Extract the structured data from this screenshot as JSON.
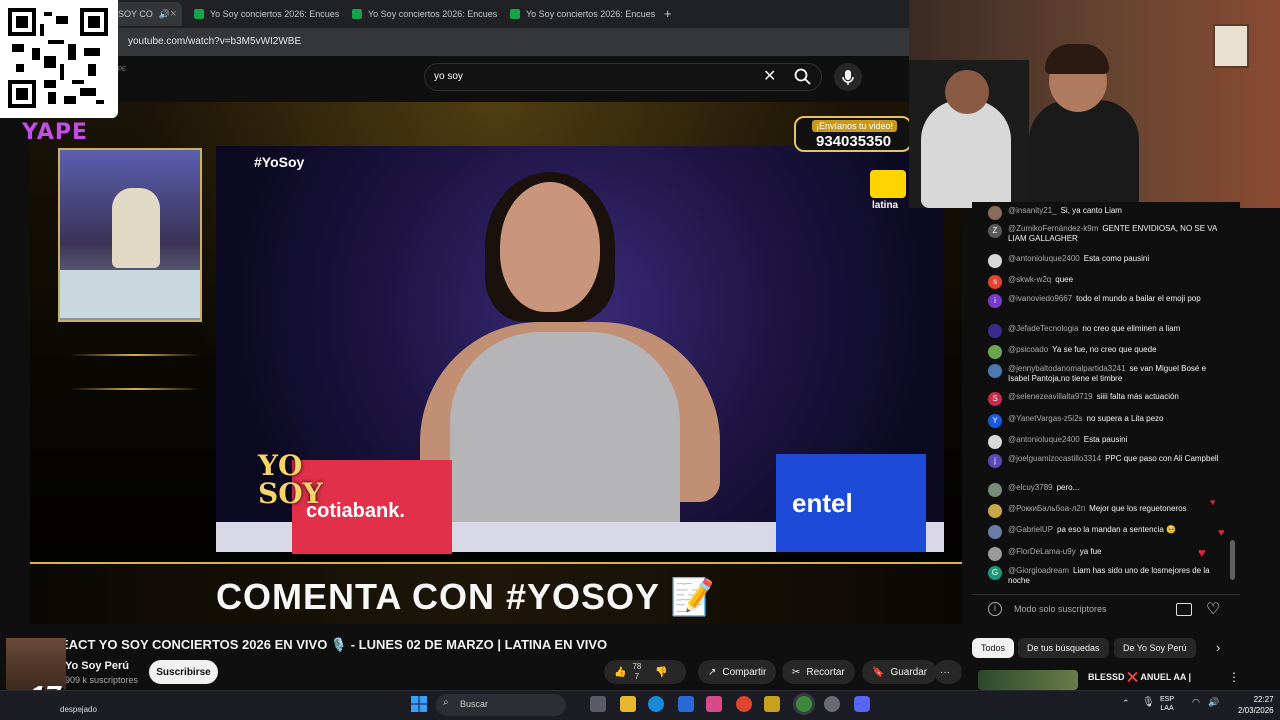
{
  "browser": {
    "tabs": [
      {
        "label": "SOY CO"
      },
      {
        "label": "Yo Soy conciertos 2026: Encues"
      },
      {
        "label": "Yo Soy conciertos 2026: Encues"
      },
      {
        "label": "Yo Soy conciertos 2026: Encues"
      }
    ],
    "url": "youtube.com/watch?v=b3M5vWI2WBE"
  },
  "overlay": {
    "yape_label": "YAPE",
    "logo_small": "PE"
  },
  "youtube": {
    "search_value": "yo soy"
  },
  "video": {
    "hashtag": "#YoSoy",
    "channel_logo": "latina",
    "phone_title": "¡Envíanos tu video!",
    "phone_number": "934035350",
    "sponsor_left": "cotiabank.",
    "sponsor_right": "entel",
    "yosoy_logo_line1": "YO",
    "yosoy_logo_line2": "SOY",
    "banner": "COMENTA CON #YOSOY 📝"
  },
  "video_info": {
    "title": "EACT YO SOY CONCIERTOS 2026 EN VIVO 🎙️ - LUNES 02 DE MARZO | LATINA EN VIVO",
    "channel": "Yo Soy Perú",
    "subscribers": "909 k suscriptores",
    "subscribe_label": "Suscribirse",
    "likes_top": "78",
    "likes_bottom": "7",
    "share_label": "Compartir",
    "clip_label": "Recortar",
    "save_label": "Guardar",
    "more_label": "···"
  },
  "chat": {
    "messages": [
      {
        "author": "@insanity21_",
        "text": "Si, ya canto Liam",
        "avatar_color": "#8a6a5a",
        "initial": ""
      },
      {
        "author": "@ZumikoFernández-k9m",
        "text": "GENTE ENVIDIOSA, NO SE VA LIAM GALLAGHER",
        "avatar_color": "#5a5a5a",
        "initial": "Z"
      },
      {
        "author": "@antonioluque2400",
        "text": "Esta como pausini",
        "avatar_color": "#d8d8d8",
        "initial": ""
      },
      {
        "author": "@skwk-w2q",
        "text": "quee",
        "avatar_color": "#e0442e",
        "initial": "s"
      },
      {
        "author": "@ivanoviedo9667",
        "text": "todo el mundo a bailar el emoji pop",
        "avatar_color": "#7a3ac8",
        "initial": "i"
      },
      {
        "author": "@JefadeTecnologia",
        "text": "no creo que eliminen a liam",
        "avatar_color": "#3a2a8a",
        "initial": ""
      },
      {
        "author": "@psicoado",
        "text": "Ya se fue, no creo que quede",
        "avatar_color": "#6aa84f",
        "initial": ""
      },
      {
        "author": "@jennybaltodanomalpartida3241",
        "text": "se van Miguel Bosé e Isabel Pantoja,no tiene el timbre",
        "avatar_color": "#4a7ab0",
        "initial": ""
      },
      {
        "author": "@selenezeavillalta9719",
        "text": "siiii falta más actuación",
        "avatar_color": "#c82a4a",
        "initial": "S"
      },
      {
        "author": "@YanetVargas-z5i2s",
        "text": "no supera a Lita pezo",
        "avatar_color": "#1a5ad8",
        "initial": "Y"
      },
      {
        "author": "@antonioluque2400",
        "text": "Esta pausini",
        "avatar_color": "#d8d8d8",
        "initial": ""
      },
      {
        "author": "@joelguamizocastillo3314",
        "text": "PPC que paso con Ali Campbell",
        "avatar_color": "#5a4ab8",
        "initial": "j"
      },
      {
        "author": "@elcuy3789",
        "text": "pero...",
        "avatar_color": "#7a8a7a",
        "initial": ""
      },
      {
        "author": "@РоккиБальбоа-л2п",
        "text": "Mejor que los reguetoneros",
        "avatar_color": "#c8a84a",
        "initial": ""
      },
      {
        "author": "@GabrielUP",
        "text": "pa eso la mandan a sentencia 🥺",
        "avatar_color": "#6a7aa8",
        "initial": ""
      },
      {
        "author": "@FlorDeLama-u9y",
        "text": "ya fue",
        "avatar_color": "#9a9a9a",
        "initial": ""
      },
      {
        "author": "@Giorgioadream",
        "text": "Liam has sido uno de losmejores de la noche",
        "avatar_color": "#1a9a7a",
        "initial": "G"
      }
    ],
    "footer_mode": "Modo solo suscriptores"
  },
  "chips": [
    "Todos",
    "De tus búsquedas",
    "De Yo Soy Perú"
  ],
  "recommendation": {
    "title": "BLESSD ❌ ANUEL AA |"
  },
  "emote": {
    "text": "x17"
  },
  "taskbar": {
    "weather": "despejado",
    "search_placeholder": "Buscar",
    "lang_line1": "ESP",
    "lang_line2": "LAA",
    "time": "22:27",
    "date": "2/03/2026"
  }
}
